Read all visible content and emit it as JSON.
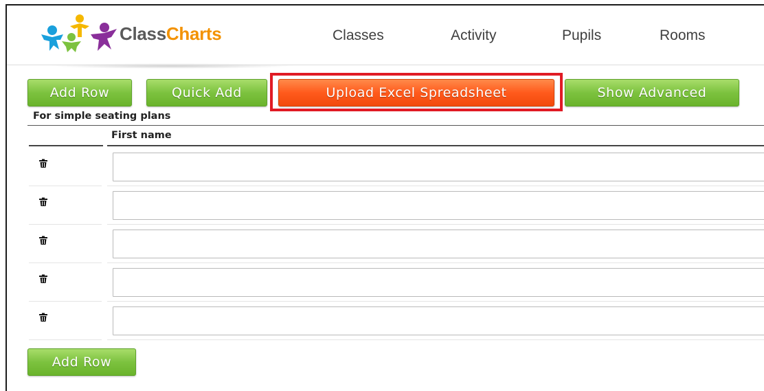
{
  "brand": {
    "name_part1": "Class",
    "name_part2": "Charts",
    "accent_orange": "#f39200",
    "text_grey": "#5a5a5a"
  },
  "nav": [
    {
      "label": "Classes"
    },
    {
      "label": "Activity"
    },
    {
      "label": "Pupils"
    },
    {
      "label": "Rooms"
    }
  ],
  "toolbar": {
    "add_row_label": "Add Row",
    "quick_add_label": "Quick Add",
    "upload_label": "Upload Excel Spreadsheet",
    "show_advanced_label": "Show Advanced",
    "green": "#7cc23f",
    "orange": "#ff5a1c",
    "highlight": "#e01b24"
  },
  "section": {
    "caption": "For simple seating plans"
  },
  "table": {
    "column_header": "First name",
    "rows": [
      {
        "first_name": ""
      },
      {
        "first_name": ""
      },
      {
        "first_name": ""
      },
      {
        "first_name": ""
      },
      {
        "first_name": ""
      }
    ],
    "row_icon": "trash-icon"
  },
  "footer": {
    "add_row_label": "Add Row"
  }
}
